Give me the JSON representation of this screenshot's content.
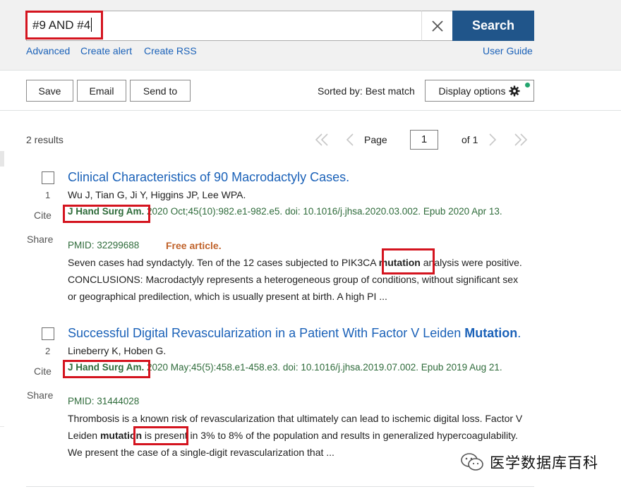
{
  "search": {
    "query": "#9 AND #4",
    "button_label": "Search",
    "links": {
      "advanced": "Advanced",
      "create_alert": "Create alert",
      "create_rss": "Create RSS",
      "user_guide": "User Guide"
    }
  },
  "toolbar": {
    "save": "Save",
    "email": "Email",
    "send_to": "Send to",
    "sorted_by": "Sorted by: Best match",
    "display_options": "Display options"
  },
  "pagination": {
    "results_count": "2 results",
    "page_label": "Page",
    "current_page": "1",
    "of_label": "of 1"
  },
  "results": [
    {
      "number": "1",
      "cite": "Cite",
      "share": "Share",
      "title": "Clinical Characteristics of 90 Macrodactyly Cases.",
      "authors": "Wu J, Tian G, Ji Y, Higgins JP, Lee WPA.",
      "journal": "J Hand Surg Am.",
      "citation_rest": " 2020 Oct;45(10):982.e1-982.e5. doi: 10.1016/j.jhsa.2020.03.002. Epub 2020 Apr 13.",
      "pmid": "PMID: 32299688",
      "free": "Free article.",
      "snippet_before": "Seven cases had syndactyly. Ten of the 12 cases subjected to PIK3CA ",
      "snippet_highlight": "mutation",
      "snippet_after": " analysis were positive. CONCLUSIONS: Macrodactyly represents a heterogeneous group of conditions, without significant sex or geographical predilection, which is usually present at birth. A high PI ..."
    },
    {
      "number": "2",
      "cite": "Cite",
      "share": "Share",
      "title": "Successful Digital Revascularization in a Patient With Factor V Leiden ",
      "title_highlight": "Mutation",
      "title_end": ".",
      "authors": "Lineberry K, Hoben G.",
      "journal": "J Hand Surg Am.",
      "citation_rest": " 2020 May;45(5):458.e1-458.e3. doi: 10.1016/j.jhsa.2019.07.002. Epub 2019 Aug 21.",
      "pmid": "PMID: 31444028",
      "snippet_before": "Thrombosis is a known risk of revascularization that ultimately can lead to ischemic digital loss. Factor V Leiden ",
      "snippet_highlight": "mutation",
      "snippet_after": " is present in 3% to 8% of the population and results in generalized hypercoagulability. We present the case of a single-digit revascularization that ..."
    }
  ],
  "watermark": "医学数据库百科",
  "icons": {
    "clear": "close-icon",
    "settings": "gear-icon",
    "first": "double-chevron-left-icon",
    "prev": "chevron-left-icon",
    "next": "chevron-right-icon",
    "last": "double-chevron-right-icon",
    "wechat": "wechat-icon"
  },
  "colors": {
    "search_button": "#20558a",
    "link": "#1a61b8",
    "citation": "#2e6b3a",
    "free_article": "#c0622a",
    "annotation_box": "#d4141f",
    "status_dot": "#23a56e"
  }
}
